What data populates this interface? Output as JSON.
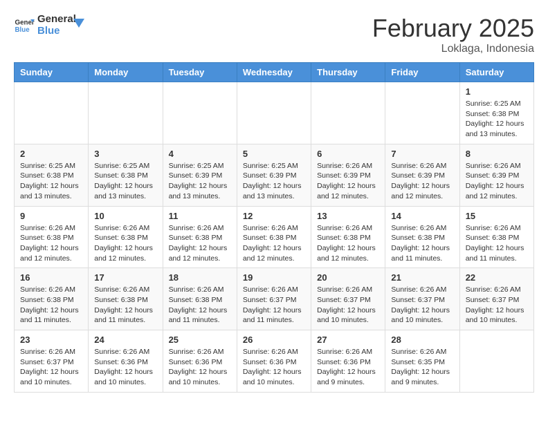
{
  "header": {
    "logo_line1": "General",
    "logo_line2": "Blue",
    "month_title": "February 2025",
    "location": "Loklaga, Indonesia"
  },
  "days_of_week": [
    "Sunday",
    "Monday",
    "Tuesday",
    "Wednesday",
    "Thursday",
    "Friday",
    "Saturday"
  ],
  "weeks": [
    [
      {
        "day": "",
        "info": ""
      },
      {
        "day": "",
        "info": ""
      },
      {
        "day": "",
        "info": ""
      },
      {
        "day": "",
        "info": ""
      },
      {
        "day": "",
        "info": ""
      },
      {
        "day": "",
        "info": ""
      },
      {
        "day": "1",
        "info": "Sunrise: 6:25 AM\nSunset: 6:38 PM\nDaylight: 12 hours\nand 13 minutes."
      }
    ],
    [
      {
        "day": "2",
        "info": "Sunrise: 6:25 AM\nSunset: 6:38 PM\nDaylight: 12 hours\nand 13 minutes."
      },
      {
        "day": "3",
        "info": "Sunrise: 6:25 AM\nSunset: 6:38 PM\nDaylight: 12 hours\nand 13 minutes."
      },
      {
        "day": "4",
        "info": "Sunrise: 6:25 AM\nSunset: 6:39 PM\nDaylight: 12 hours\nand 13 minutes."
      },
      {
        "day": "5",
        "info": "Sunrise: 6:25 AM\nSunset: 6:39 PM\nDaylight: 12 hours\nand 13 minutes."
      },
      {
        "day": "6",
        "info": "Sunrise: 6:26 AM\nSunset: 6:39 PM\nDaylight: 12 hours\nand 12 minutes."
      },
      {
        "day": "7",
        "info": "Sunrise: 6:26 AM\nSunset: 6:39 PM\nDaylight: 12 hours\nand 12 minutes."
      },
      {
        "day": "8",
        "info": "Sunrise: 6:26 AM\nSunset: 6:39 PM\nDaylight: 12 hours\nand 12 minutes."
      }
    ],
    [
      {
        "day": "9",
        "info": "Sunrise: 6:26 AM\nSunset: 6:38 PM\nDaylight: 12 hours\nand 12 minutes."
      },
      {
        "day": "10",
        "info": "Sunrise: 6:26 AM\nSunset: 6:38 PM\nDaylight: 12 hours\nand 12 minutes."
      },
      {
        "day": "11",
        "info": "Sunrise: 6:26 AM\nSunset: 6:38 PM\nDaylight: 12 hours\nand 12 minutes."
      },
      {
        "day": "12",
        "info": "Sunrise: 6:26 AM\nSunset: 6:38 PM\nDaylight: 12 hours\nand 12 minutes."
      },
      {
        "day": "13",
        "info": "Sunrise: 6:26 AM\nSunset: 6:38 PM\nDaylight: 12 hours\nand 12 minutes."
      },
      {
        "day": "14",
        "info": "Sunrise: 6:26 AM\nSunset: 6:38 PM\nDaylight: 12 hours\nand 11 minutes."
      },
      {
        "day": "15",
        "info": "Sunrise: 6:26 AM\nSunset: 6:38 PM\nDaylight: 12 hours\nand 11 minutes."
      }
    ],
    [
      {
        "day": "16",
        "info": "Sunrise: 6:26 AM\nSunset: 6:38 PM\nDaylight: 12 hours\nand 11 minutes."
      },
      {
        "day": "17",
        "info": "Sunrise: 6:26 AM\nSunset: 6:38 PM\nDaylight: 12 hours\nand 11 minutes."
      },
      {
        "day": "18",
        "info": "Sunrise: 6:26 AM\nSunset: 6:38 PM\nDaylight: 12 hours\nand 11 minutes."
      },
      {
        "day": "19",
        "info": "Sunrise: 6:26 AM\nSunset: 6:37 PM\nDaylight: 12 hours\nand 11 minutes."
      },
      {
        "day": "20",
        "info": "Sunrise: 6:26 AM\nSunset: 6:37 PM\nDaylight: 12 hours\nand 10 minutes."
      },
      {
        "day": "21",
        "info": "Sunrise: 6:26 AM\nSunset: 6:37 PM\nDaylight: 12 hours\nand 10 minutes."
      },
      {
        "day": "22",
        "info": "Sunrise: 6:26 AM\nSunset: 6:37 PM\nDaylight: 12 hours\nand 10 minutes."
      }
    ],
    [
      {
        "day": "23",
        "info": "Sunrise: 6:26 AM\nSunset: 6:37 PM\nDaylight: 12 hours\nand 10 minutes."
      },
      {
        "day": "24",
        "info": "Sunrise: 6:26 AM\nSunset: 6:36 PM\nDaylight: 12 hours\nand 10 minutes."
      },
      {
        "day": "25",
        "info": "Sunrise: 6:26 AM\nSunset: 6:36 PM\nDaylight: 12 hours\nand 10 minutes."
      },
      {
        "day": "26",
        "info": "Sunrise: 6:26 AM\nSunset: 6:36 PM\nDaylight: 12 hours\nand 10 minutes."
      },
      {
        "day": "27",
        "info": "Sunrise: 6:26 AM\nSunset: 6:36 PM\nDaylight: 12 hours\nand 9 minutes."
      },
      {
        "day": "28",
        "info": "Sunrise: 6:26 AM\nSunset: 6:35 PM\nDaylight: 12 hours\nand 9 minutes."
      },
      {
        "day": "",
        "info": ""
      }
    ]
  ]
}
